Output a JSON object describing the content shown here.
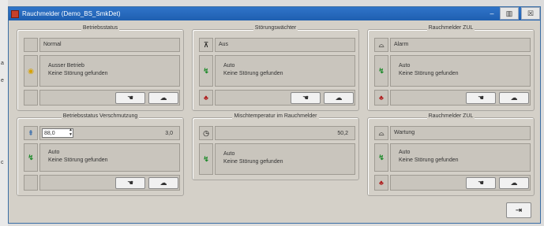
{
  "window": {
    "title": "Rauchmelder (Demo_BS_SmkDet)",
    "buttons": {
      "minimize": "–",
      "restore": "▥",
      "close": "☒"
    }
  },
  "left_edge_text": [
    "a",
    "e",
    "c"
  ],
  "groups": {
    "betriebsstatus": {
      "title": "Betriebsstatus",
      "status_field": "Normal",
      "message_line1": "Ausser Betrieb",
      "message_line2": "Keine Störung gefunden"
    },
    "stoerungswaechter": {
      "title": "Störungswächter",
      "status_field": "Aus",
      "message_line1": "Auto",
      "message_line2": "Keine Störung gefunden"
    },
    "rauchmelder_zul_1": {
      "title": "Rauchmelder ZUL",
      "status_field": "Alarm",
      "message_line1": "Auto",
      "message_line2": "Keine Störung gefunden"
    },
    "betriebsstatus_verschmutzung": {
      "title": "Betriebsstatus Verschmutzung",
      "spin_value": "88,0",
      "value_field": "3,0",
      "message_line1": "Auto",
      "message_line2": "Keine Störung gefunden"
    },
    "mischtemperatur": {
      "title": "Mischtemperatur im Rauchmelder",
      "value_field": "50,2",
      "message_line1": "Auto",
      "message_line2": "Keine Störung gefunden"
    },
    "rauchmelder_zul_2": {
      "title": "Rauchmelder ZUL",
      "status_field": "Wartung",
      "message_line1": "Auto",
      "message_line2": "Keine Störung gefunden"
    }
  },
  "icons": {
    "hand": "☚",
    "cloud": "☁",
    "exit": "⇥",
    "ack": "↯",
    "bell": "♣",
    "detector": "⌓",
    "clock": "◷",
    "switch": "⊼",
    "traffic": "◉",
    "up": "▲",
    "down": "▼",
    "reset": "⇞"
  },
  "colors": {
    "titlebar": "#2f74c9",
    "panel": "#d4d0c8"
  }
}
